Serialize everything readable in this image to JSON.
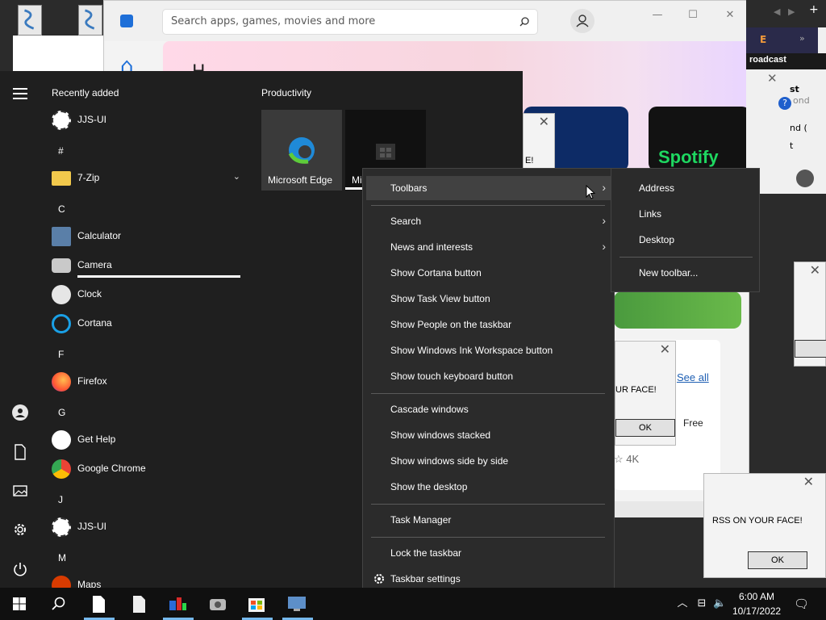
{
  "store": {
    "search_placeholder": "Search apps, games, movies and more",
    "see_all": "See all",
    "free": "Free",
    "rating": "☆ 4K",
    "tile_spotify": "Spotify",
    "hero_text": "H"
  },
  "alerts": {
    "a1_msg": "E!",
    "a2_msg": "UR FACE!",
    "a2_ok": "OK",
    "a3_msg": "RSS ON YOUR FACE!",
    "a3_ok": "OK"
  },
  "right_window": {
    "broadcast": "roadcast",
    "header_letter": "E",
    "lines": [
      "st",
      "ond",
      "nd (",
      "t"
    ]
  },
  "start_menu": {
    "recently_added": "Recently added",
    "productivity": "Productivity",
    "apps": [
      {
        "label": "JJS-UI"
      },
      {
        "letter": "#"
      },
      {
        "label": "7-Zip"
      },
      {
        "letter": "C"
      },
      {
        "label": "Calculator"
      },
      {
        "label": "Camera"
      },
      {
        "label": "Clock"
      },
      {
        "label": "Cortana"
      },
      {
        "letter": "F"
      },
      {
        "label": "Firefox"
      },
      {
        "letter": "G"
      },
      {
        "label": "Get Help"
      },
      {
        "label": "Google Chrome"
      },
      {
        "letter": "J"
      },
      {
        "label": "JJS-UI"
      },
      {
        "letter": "M"
      },
      {
        "label": "Maps"
      }
    ],
    "tiles": [
      {
        "label": "Microsoft Edge"
      },
      {
        "label": "Mi"
      }
    ]
  },
  "context_menu": {
    "items": [
      {
        "label": "Toolbars",
        "submenu": true
      },
      {
        "label": "Search",
        "submenu": true
      },
      {
        "label": "News and interests",
        "submenu": true
      },
      {
        "label": "Show Cortana button"
      },
      {
        "label": "Show Task View button"
      },
      {
        "label": "Show People on the taskbar"
      },
      {
        "label": "Show Windows Ink Workspace button"
      },
      {
        "label": "Show touch keyboard button"
      },
      {
        "label": "Cascade windows"
      },
      {
        "label": "Show windows stacked"
      },
      {
        "label": "Show windows side by side"
      },
      {
        "label": "Show the desktop"
      },
      {
        "label": "Task Manager"
      },
      {
        "label": "Lock the taskbar"
      },
      {
        "label": "Taskbar settings"
      }
    ],
    "arrow_glyph": "›"
  },
  "submenu": {
    "items": [
      "Address",
      "Links",
      "Desktop",
      "New toolbar..."
    ]
  },
  "taskbar": {
    "time": "6:00 AM",
    "date": "10/17/2022"
  },
  "colors": {
    "accent": "#76b9ed",
    "start_bg": "#1f1f1f",
    "menu_bg": "#2b2b2b",
    "taskbar_bg": "#101010",
    "spotify_green": "#1ed760"
  }
}
